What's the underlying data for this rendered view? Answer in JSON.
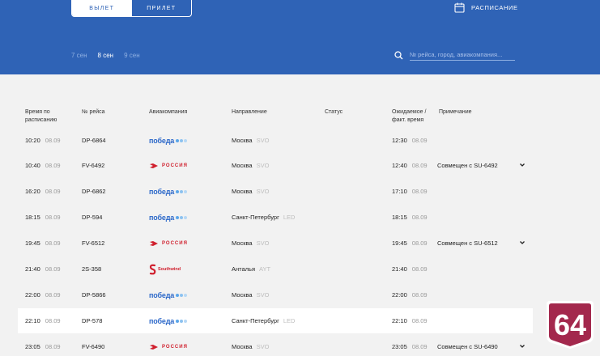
{
  "tabs": {
    "departure": "ВЫЛЕТ",
    "arrival": "ПРИЛЕТ"
  },
  "schedule_label": "РАСПИСАНИЕ",
  "dates": [
    "7 сен",
    "8 сен",
    "9 сен"
  ],
  "search": {
    "placeholder": "№ рейса, город, авиакомпания..."
  },
  "columns": {
    "scheduled": "Время по расписанию",
    "flight": "№ рейса",
    "airline": "Авиакомпания",
    "destination": "Направление",
    "status": "Статус",
    "expected": "Ожидаемое / факт. время",
    "note": "Примечание"
  },
  "airline_logos": {
    "pobeda": "победа",
    "rossiya": "РОССИЯ",
    "southwind": "Southwind"
  },
  "flights": [
    {
      "time": "10:20",
      "date": "08.09",
      "flight": "DP-6864",
      "airline": "pobeda",
      "city": "Москва",
      "iata": "SVO",
      "exp_time": "12:30",
      "exp_date": "08.09",
      "note": ""
    },
    {
      "time": "10:40",
      "date": "08.09",
      "flight": "FV-6492",
      "airline": "rossiya",
      "city": "Москва",
      "iata": "SVO",
      "exp_time": "12:40",
      "exp_date": "08.09",
      "note": "Совмещен с SU-6492"
    },
    {
      "time": "16:20",
      "date": "08.09",
      "flight": "DP-6862",
      "airline": "pobeda",
      "city": "Москва",
      "iata": "SVO",
      "exp_time": "17:10",
      "exp_date": "08.09",
      "note": ""
    },
    {
      "time": "18:15",
      "date": "08.09",
      "flight": "DP-594",
      "airline": "pobeda",
      "city": "Санкт-Петербург",
      "iata": "LED",
      "exp_time": "18:15",
      "exp_date": "08.09",
      "note": ""
    },
    {
      "time": "19:45",
      "date": "08.09",
      "flight": "FV-6512",
      "airline": "rossiya",
      "city": "Москва",
      "iata": "SVO",
      "exp_time": "19:45",
      "exp_date": "08.09",
      "note": "Совмещен с SU-6512"
    },
    {
      "time": "21:40",
      "date": "08.09",
      "flight": "2S-358",
      "airline": "southwind",
      "city": "Анталья",
      "iata": "AYT",
      "exp_time": "21:40",
      "exp_date": "08.09",
      "note": ""
    },
    {
      "time": "22:00",
      "date": "08.09",
      "flight": "DP-5866",
      "airline": "pobeda",
      "city": "Москва",
      "iata": "SVO",
      "exp_time": "22:00",
      "exp_date": "08.09",
      "note": ""
    },
    {
      "time": "22:10",
      "date": "08.09",
      "flight": "DP-578",
      "airline": "pobeda",
      "city": "Санкт-Петербург",
      "iata": "LED",
      "exp_time": "22:10",
      "exp_date": "08.09",
      "note": ""
    },
    {
      "time": "23:05",
      "date": "08.09",
      "flight": "FV-6490",
      "airline": "rossiya",
      "city": "Москва",
      "iata": "SVO",
      "exp_time": "23:05",
      "exp_date": "08.09",
      "note": "Совмещен с SU-6490"
    }
  ],
  "badge_text": "64",
  "colors": {
    "header": "#2f63b6",
    "pobeda": "#2c68c9",
    "rossiya": "#d0202e",
    "badge": "#a3284d"
  }
}
